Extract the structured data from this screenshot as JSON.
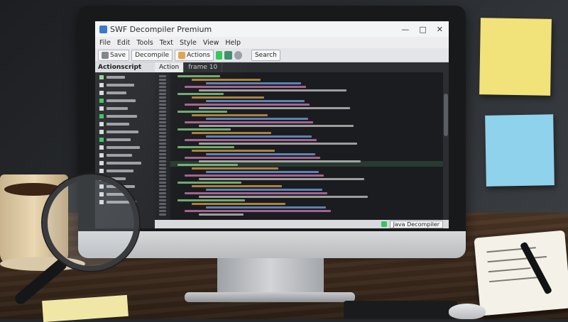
{
  "window": {
    "title": "SWF Decompiler Premium",
    "controls": [
      "—",
      "□",
      "✕"
    ]
  },
  "menu": [
    "File",
    "Edit",
    "Tools",
    "Text",
    "Style",
    "View",
    "Help"
  ],
  "toolbar": {
    "buttons": [
      "Save",
      "Decompile",
      "Actions",
      "Search"
    ]
  },
  "sidebar": {
    "header": "Actionscript"
  },
  "tabs": [
    "Action",
    "frame 10"
  ],
  "statusbar": {
    "item_right": "Java Decompiler"
  },
  "colors": {
    "accent_green": "#34c759",
    "code_green": "#8bd98b",
    "code_orange": "#e0a24a",
    "code_blue": "#6fa7e6",
    "code_pink": "#d57ab8"
  },
  "icons": [
    "app-icon",
    "tree-arrow-icon",
    "magnifier-icon"
  ]
}
